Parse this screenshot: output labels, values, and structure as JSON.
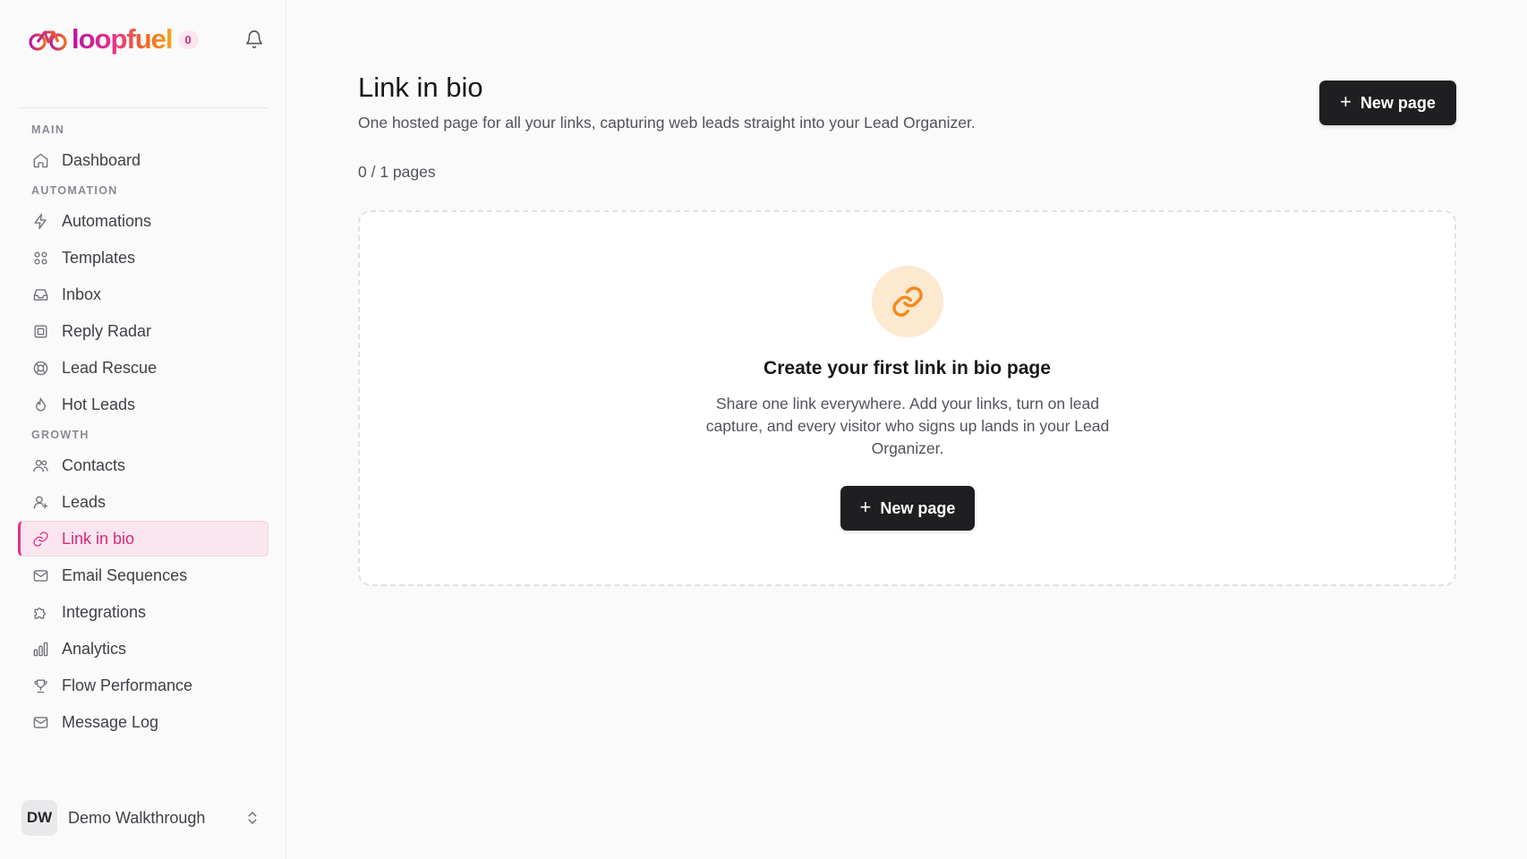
{
  "brand": {
    "name": "Loopfuel",
    "logo_text": "loopfuel",
    "notification_count": "0"
  },
  "sidebar": {
    "sections": [
      {
        "label": "MAIN",
        "items": [
          {
            "label": "Dashboard",
            "icon": "home-icon"
          }
        ]
      },
      {
        "label": "AUTOMATION",
        "items": [
          {
            "label": "Automations",
            "icon": "bolt-icon"
          },
          {
            "label": "Templates",
            "icon": "grid-icon"
          },
          {
            "label": "Inbox",
            "icon": "inbox-icon"
          },
          {
            "label": "Reply Radar",
            "icon": "radar-icon"
          },
          {
            "label": "Lead Rescue",
            "icon": "lifebuoy-icon"
          },
          {
            "label": "Hot Leads",
            "icon": "flame-icon"
          }
        ]
      },
      {
        "label": "GROWTH",
        "items": [
          {
            "label": "Contacts",
            "icon": "users-icon"
          },
          {
            "label": "Leads",
            "icon": "user-plus-icon"
          },
          {
            "label": "Link in bio",
            "icon": "link-icon",
            "active": true
          },
          {
            "label": "Email Sequences",
            "icon": "mail-icon"
          },
          {
            "label": "Integrations",
            "icon": "puzzle-icon"
          },
          {
            "label": "Analytics",
            "icon": "bar-chart-icon"
          },
          {
            "label": "Flow Performance",
            "icon": "trophy-icon"
          },
          {
            "label": "Message Log",
            "icon": "mail-icon"
          }
        ]
      }
    ]
  },
  "user": {
    "initials": "DW",
    "name": "Demo Walkthrough"
  },
  "main": {
    "title": "Link in bio",
    "subtitle": "One hosted page for all your links, capturing web leads straight into your Lead Organizer.",
    "page_count": "0 / 1 pages",
    "new_page_label": "New page",
    "empty": {
      "title": "Create your first link in bio page",
      "description": "Share one link everywhere. Add your links, turn on lead capture, and every visitor who signs up lands in your Lead Organizer.",
      "button_label": "New page"
    }
  },
  "colors": {
    "accent": "#e8308a",
    "active_bg": "#fbe6ef",
    "button_dark": "#1f1f22",
    "link_icon": "#f28b1e",
    "link_icon_bg": "#fde8d0"
  }
}
